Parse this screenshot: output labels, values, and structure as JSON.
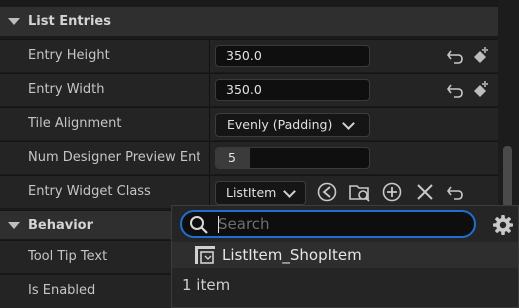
{
  "sections": {
    "list_entries": "List Entries",
    "behavior": "Behavior"
  },
  "properties": {
    "entry_height": {
      "label": "Entry Height",
      "value": "350.0"
    },
    "entry_width": {
      "label": "Entry Width",
      "value": "350.0"
    },
    "tile_alignment": {
      "label": "Tile Alignment",
      "value": "Evenly (Padding)"
    },
    "num_preview": {
      "label": "Num Designer Preview Entr",
      "value": "5"
    },
    "entry_widget_class": {
      "label": "Entry Widget Class",
      "value": "ListItem"
    },
    "tool_tip_text": {
      "label": "Tool Tip Text"
    },
    "is_enabled": {
      "label": "Is Enabled"
    }
  },
  "picker": {
    "search_placeholder": "Search",
    "results": [
      {
        "label": "ListItem_ShopItem"
      }
    ],
    "count_text": "1 item"
  },
  "icons": {
    "reset": "reset-arrow-icon",
    "add_key": "add-key-icon",
    "browse": "browse-icon",
    "use_selected": "use-selected-icon",
    "add": "add-icon",
    "clear": "clear-icon",
    "settings": "gear-icon",
    "search": "search-icon"
  },
  "colors": {
    "accent": "#1f6fcf",
    "panel": "#242424",
    "section": "#2f2f2f"
  }
}
